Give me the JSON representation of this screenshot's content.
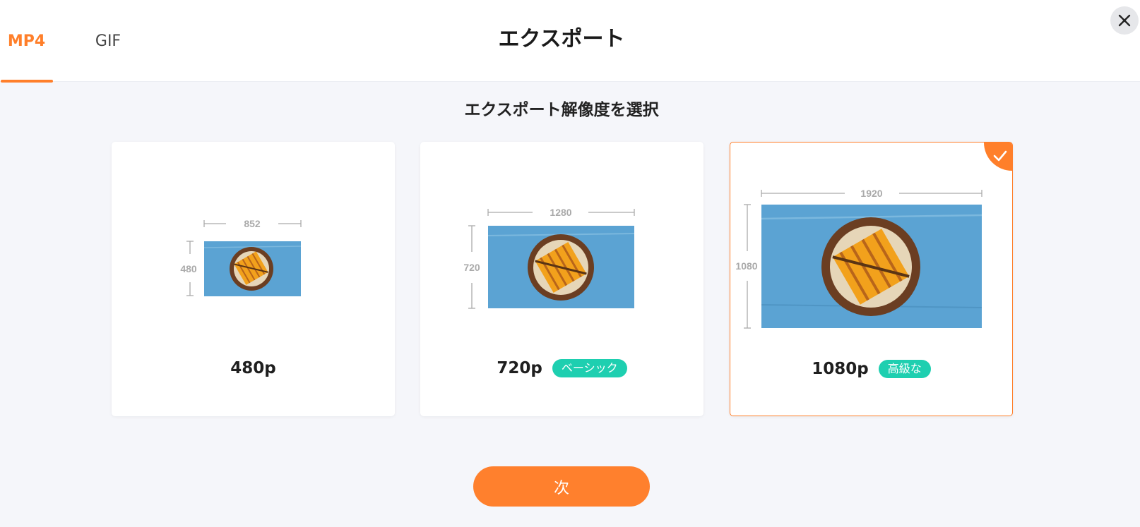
{
  "tabs": [
    {
      "label": "MP4",
      "active": true
    },
    {
      "label": "GIF",
      "active": false
    }
  ],
  "title": "エクスポート",
  "subtitle": "エクスポート解像度を選択",
  "close_icon": "close-icon",
  "colors": {
    "accent": "#ff7f2a",
    "badge": "#1ecfb0",
    "preview_blue": "#5ba3d3"
  },
  "options": [
    {
      "label": "480p",
      "width_label": "852",
      "height_label": "480",
      "badge": "",
      "selected": false
    },
    {
      "label": "720p",
      "width_label": "1280",
      "height_label": "720",
      "badge": "ベーシック",
      "selected": false
    },
    {
      "label": "1080p",
      "width_label": "1920",
      "height_label": "1080",
      "badge": "高級な",
      "selected": true
    }
  ],
  "next_button": "次"
}
